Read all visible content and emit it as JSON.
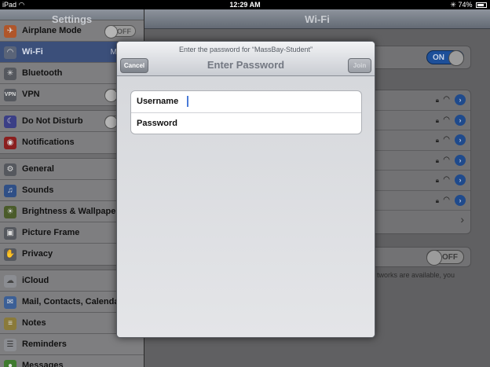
{
  "statusbar": {
    "device": "iPad",
    "wifi_icon": "wifi-icon",
    "time": "12:29 AM",
    "bluetooth_icon": "bluetooth-icon",
    "battery": "74%",
    "battery_icon": "battery-icon"
  },
  "master": {
    "title": "Settings",
    "groups": [
      [
        {
          "label": "Airplane Mode",
          "icon": "airplane-icon",
          "toggle": "OFF"
        },
        {
          "label": "Wi-Fi",
          "icon": "wifi-icon",
          "value": "MEDIAS",
          "selected": true
        },
        {
          "label": "Bluetooth",
          "icon": "bluetooth-icon"
        },
        {
          "label": "VPN",
          "icon": "vpn-icon"
        }
      ],
      [
        {
          "label": "Do Not Disturb",
          "icon": "moon-icon"
        },
        {
          "label": "Notifications",
          "icon": "notifications-icon"
        }
      ],
      [
        {
          "label": "General",
          "icon": "gear-icon"
        },
        {
          "label": "Sounds",
          "icon": "speaker-icon"
        },
        {
          "label": "Brightness & Wallpaper",
          "icon": "brightness-icon"
        },
        {
          "label": "Picture Frame",
          "icon": "picture-frame-icon"
        },
        {
          "label": "Privacy",
          "icon": "hand-icon"
        }
      ],
      [
        {
          "label": "iCloud",
          "icon": "cloud-icon"
        },
        {
          "label": "Mail, Contacts, Calendars",
          "icon": "mail-icon"
        },
        {
          "label": "Notes",
          "icon": "notes-icon"
        },
        {
          "label": "Reminders",
          "icon": "reminders-icon"
        },
        {
          "label": "Messages",
          "icon": "messages-icon"
        }
      ]
    ]
  },
  "detail": {
    "title": "Wi-Fi",
    "wifi_toggle": "ON",
    "ask_toggle": "OFF",
    "note": "tworks are available, you"
  },
  "modal": {
    "prompt": "Enter the password for “MassBay-Student”",
    "title": "Enter Password",
    "cancel_label": "Cancel",
    "join_label": "Join",
    "username_label": "Username",
    "username_value": "",
    "password_label": "Password",
    "password_value": ""
  }
}
